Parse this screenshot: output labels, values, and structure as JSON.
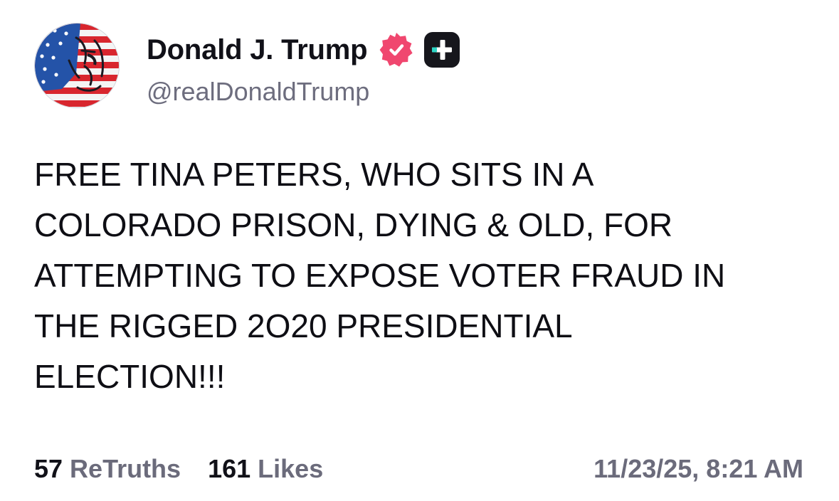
{
  "post": {
    "author": {
      "display_name": "Donald J. Trump",
      "handle": "@realDonaldTrump",
      "avatar_icon": "flag-portrait-avatar",
      "verified_icon": "verified-badge-icon",
      "plus_icon": "truth-plus-icon"
    },
    "body_lines": [
      "FREE TINA PETERS, WHO SITS IN A",
      "COLORADO PRISON, DYING & OLD, FOR",
      "ATTEMPTING TO EXPOSE VOTER FRAUD IN",
      "THE RIGGED 2O20 PRESIDENTIAL",
      "ELECTION!!!"
    ],
    "stats": {
      "retruths_count": "57",
      "retruths_label": "ReTruths",
      "likes_count": "161",
      "likes_label": "Likes"
    },
    "timestamp": "11/23/25, 8:21 AM"
  },
  "colors": {
    "text_primary": "#0e0e14",
    "text_secondary": "#6b6b7b",
    "verified_pink": "#f0476f",
    "plus_badge_bg": "#16161c",
    "plus_badge_accent": "#2dd4c4"
  }
}
